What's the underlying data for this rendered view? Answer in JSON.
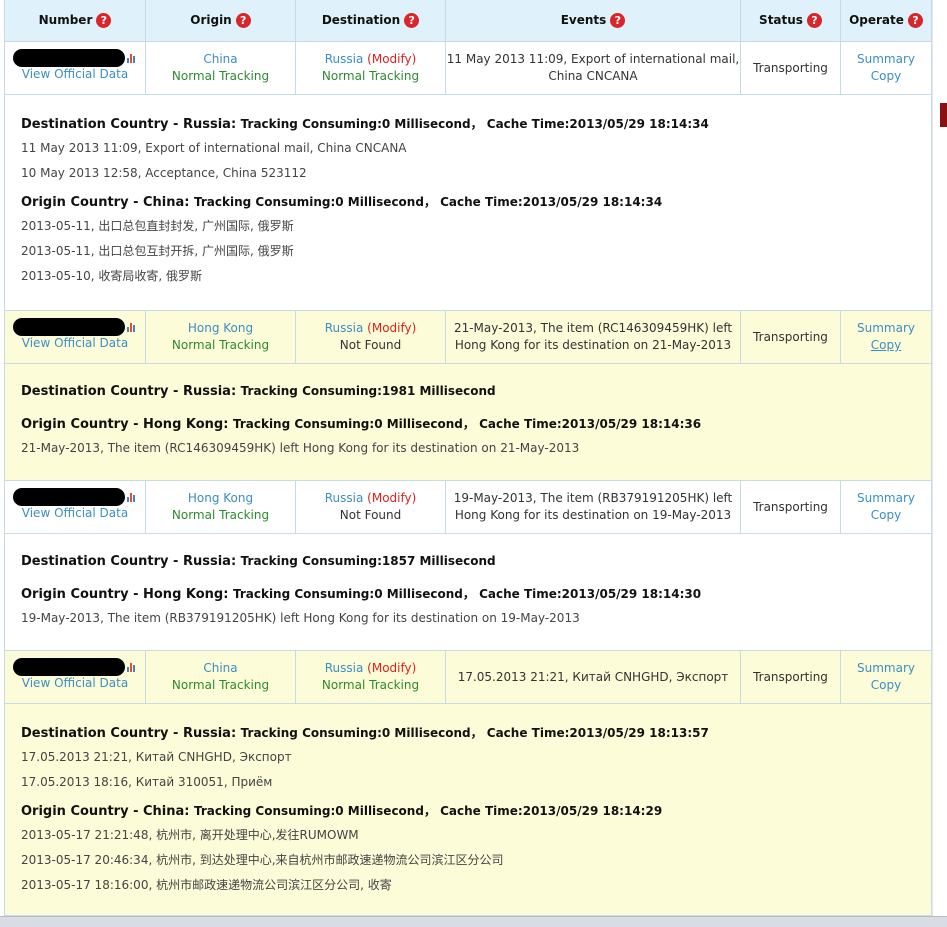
{
  "headers": {
    "number": "Number",
    "origin": "Origin",
    "destination": "Destination",
    "events": "Events",
    "status": "Status",
    "operate": "Operate",
    "help_glyph": "?"
  },
  "common": {
    "view_official": "View Official Data",
    "modify": "(Modify)",
    "summary": "Summary",
    "copy": "Copy",
    "dest_prefix": "Destination Country - ",
    "origin_prefix": "Origin Country - "
  },
  "shipments": [
    {
      "origin": "China",
      "origin_status": "Normal Tracking",
      "destination": "Russia",
      "dest_status": "Normal Tracking",
      "event_line1": "11 May 2013 11:09, Export of international mail,",
      "event_line2": "China CNCANA",
      "status": "Transporting",
      "dest_head": "Russia:",
      "dest_meta": "Tracking Consuming:0 Millisecond， Cache Time:2013/05/29 18:14:34",
      "dest_events": [
        "11 May 2013 11:09, Export of international mail, China CNCANA",
        "10 May 2013 12:58, Acceptance, China 523112"
      ],
      "origin_head": "China:",
      "origin_meta": "Tracking Consuming:0 Millisecond， Cache Time:2013/05/29 18:14:34",
      "origin_events": [
        "2013-05-11, 出口总包直封封发, 广州国际, 俄罗斯",
        "2013-05-11, 出口总包互封开拆, 广州国际, 俄罗斯",
        "2013-05-10, 收寄局收寄, 俄罗斯"
      ]
    },
    {
      "origin": "Hong Kong",
      "origin_status": "Normal Tracking",
      "destination": "Russia",
      "dest_status": "Not Found",
      "event_line1": "21-May-2013, The item (RC146309459HK) left",
      "event_line2": "Hong Kong for its destination on 21-May-2013",
      "status": "Transporting",
      "dest_head": "Russia:",
      "dest_meta": "Tracking Consuming:1981 Millisecond",
      "dest_events": [],
      "origin_head": "Hong Kong:",
      "origin_meta": "Tracking Consuming:0 Millisecond， Cache Time:2013/05/29 18:14:36",
      "origin_events": [
        "21-May-2013, The item (RC146309459HK) left Hong Kong for its destination on 21-May-2013"
      ]
    },
    {
      "origin": "Hong Kong",
      "origin_status": "Normal Tracking",
      "destination": "Russia",
      "dest_status": "Not Found",
      "event_line1": "19-May-2013, The item (RB379191205HK) left",
      "event_line2": "Hong Kong for its destination on 19-May-2013",
      "status": "Transporting",
      "dest_head": "Russia:",
      "dest_meta": "Tracking Consuming:1857 Millisecond",
      "dest_events": [],
      "origin_head": "Hong Kong:",
      "origin_meta": "Tracking Consuming:0 Millisecond， Cache Time:2013/05/29 18:14:30",
      "origin_events": [
        "19-May-2013, The item (RB379191205HK) left Hong Kong for its destination on 19-May-2013"
      ]
    },
    {
      "origin": "China",
      "origin_status": "Normal Tracking",
      "destination": "Russia",
      "dest_status": "Normal Tracking",
      "event_line1": "17.05.2013 21:21, Китай CNHGHD, Экспорт",
      "event_line2": "",
      "status": "Transporting",
      "dest_head": "Russia:",
      "dest_meta": "Tracking Consuming:0 Millisecond， Cache Time:2013/05/29 18:13:57",
      "dest_events": [
        "17.05.2013 21:21, Китай CNHGHD, Экспорт",
        "17.05.2013 18:16, Китай 310051, Приём"
      ],
      "origin_head": "China:",
      "origin_meta": "Tracking Consuming:0 Millisecond， Cache Time:2013/05/29 18:14:29",
      "origin_events": [
        "2013-05-17 21:21:48, 杭州市, 离开处理中心,发往RUMOWM",
        "2013-05-17 20:46:34, 杭州市, 到达处理中心,来自杭州市邮政速递物流公司滨江区分公司",
        "2013-05-17 18:16:00, 杭州市邮政速递物流公司滨江区分公司, 收寄"
      ]
    }
  ]
}
